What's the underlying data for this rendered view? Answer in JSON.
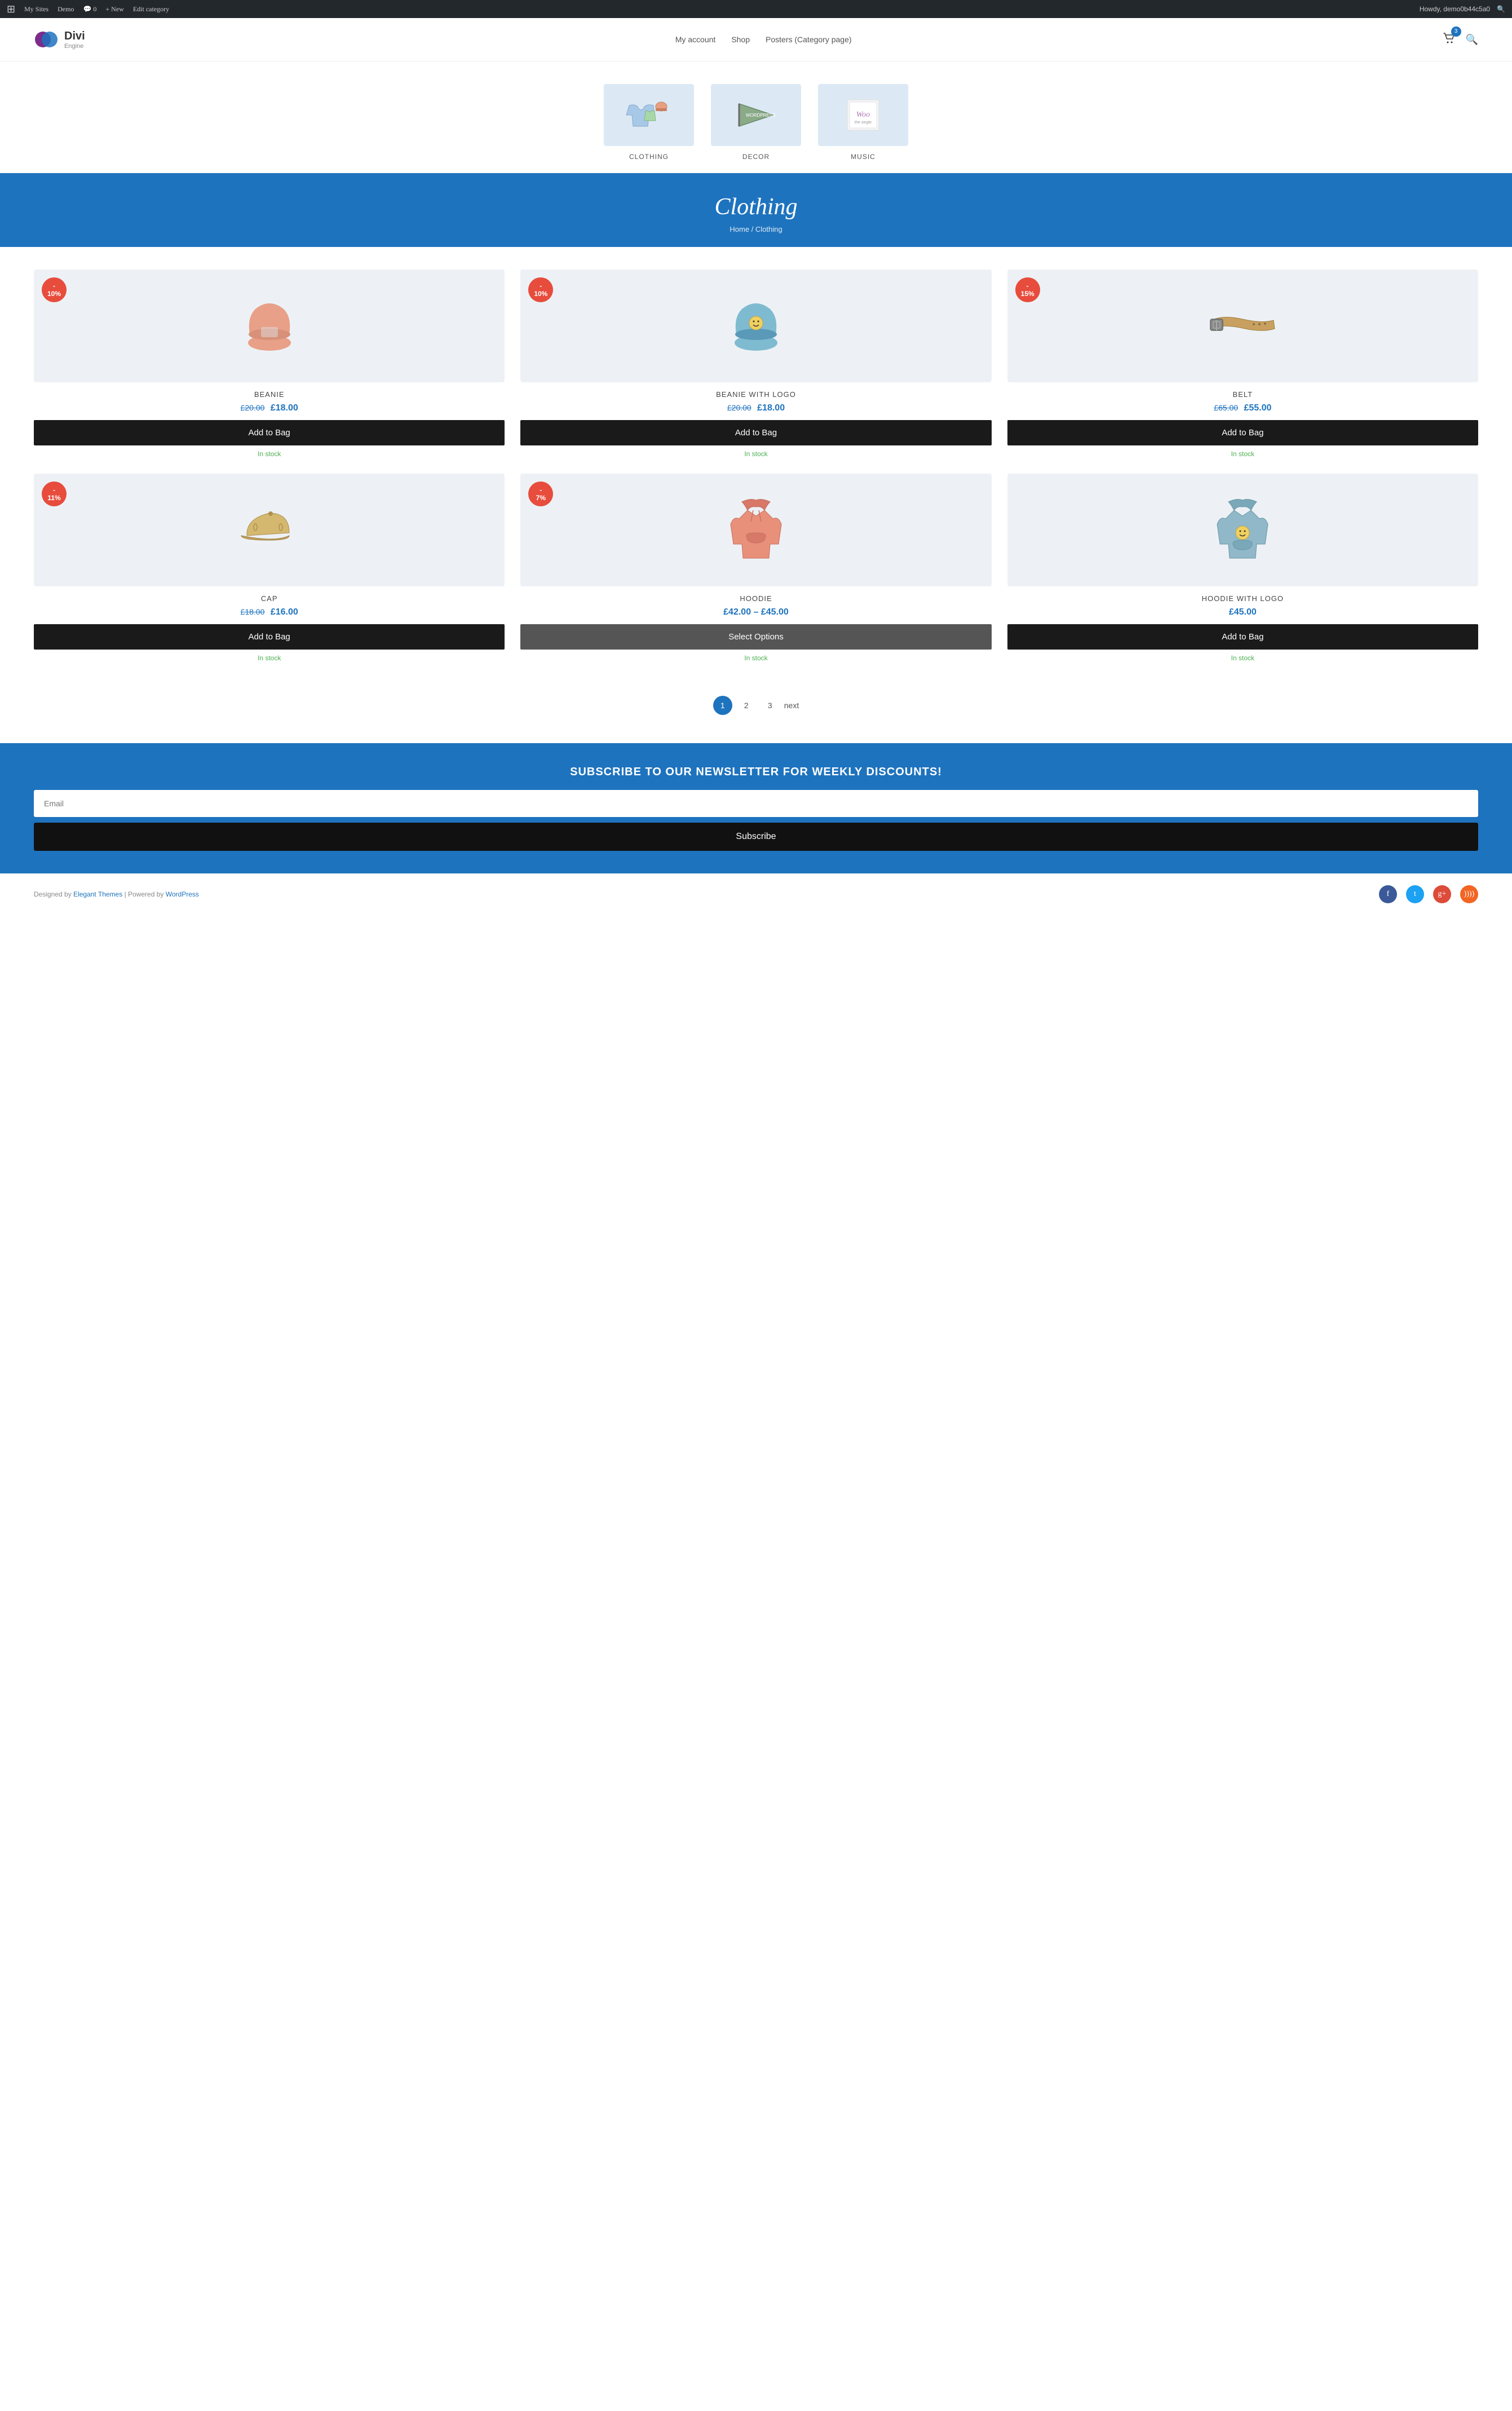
{
  "adminBar": {
    "wpLabel": "W",
    "mySites": "My Sites",
    "demo": "Demo",
    "comments": "0",
    "new": "New",
    "editCategory": "Edit category",
    "howdy": "Howdy, demo0b44c5a0"
  },
  "header": {
    "logoName": "Divi",
    "logoSub": "Engine",
    "nav": [
      {
        "label": "My account",
        "href": "#"
      },
      {
        "label": "Shop",
        "href": "#"
      },
      {
        "label": "Posters (Category page)",
        "href": "#"
      }
    ],
    "cartCount": "3"
  },
  "categories": [
    {
      "label": "CLOTHING",
      "color": "#dce9f5"
    },
    {
      "label": "DECOR",
      "color": "#dce9f5"
    },
    {
      "label": "MUSIC",
      "color": "#dce9f5"
    }
  ],
  "banner": {
    "title": "Clothing",
    "breadcrumbHome": "Home",
    "breadcrumbSep": " / ",
    "breadcrumbCurrent": "Clothing"
  },
  "products": [
    {
      "name": "BEANIE",
      "discount": "- 10%",
      "priceOld": "£20.00",
      "priceNew": "£18.00",
      "buttonLabel": "Add to Bag",
      "buttonType": "add",
      "stock": "In stock",
      "color": "#f0a090"
    },
    {
      "name": "BEANIE WITH LOGO",
      "discount": "- 10%",
      "priceOld": "£20.00",
      "priceNew": "£18.00",
      "buttonLabel": "Add to Bag",
      "buttonType": "add",
      "stock": "In stock",
      "color": "#90b8d0"
    },
    {
      "name": "BELT",
      "discount": "- 15%",
      "priceOld": "£65.00",
      "priceNew": "£55.00",
      "buttonLabel": "Add to Bag",
      "buttonType": "add",
      "stock": "In stock",
      "color": "#c8a06a"
    },
    {
      "name": "CAP",
      "discount": "- 11%",
      "priceOld": "£18.00",
      "priceNew": "£16.00",
      "buttonLabel": "Add to Bag",
      "buttonType": "add",
      "stock": "In stock",
      "color": "#d4b870"
    },
    {
      "name": "HOODIE",
      "discount": "- 7%",
      "priceOld": null,
      "priceNew": null,
      "priceRange": "£42.00 – £45.00",
      "buttonLabel": "Select Options",
      "buttonType": "select",
      "stock": "In stock",
      "color": "#e8907a"
    },
    {
      "name": "HOODIE WITH LOGO",
      "discount": null,
      "priceOld": null,
      "priceNew": null,
      "priceSingle": "£45.00",
      "buttonLabel": "Add to Bag",
      "buttonType": "add",
      "stock": "In stock",
      "color": "#90b8c8"
    }
  ],
  "pagination": {
    "pages": [
      "1",
      "2",
      "3"
    ],
    "next": "next",
    "activePage": "1"
  },
  "newsletter": {
    "title": "SUBSCRIBE TO OUR NEWSLETTER FOR WEEKLY DISCOUNTS!",
    "placeholder": "Email",
    "buttonLabel": "Subscribe"
  },
  "footer": {
    "text": "Designed by",
    "elegantThemes": "Elegant Themes",
    "poweredBy": " | Powered by ",
    "wordpress": "WordPress",
    "icons": [
      "facebook",
      "twitter",
      "google-plus",
      "rss"
    ]
  }
}
